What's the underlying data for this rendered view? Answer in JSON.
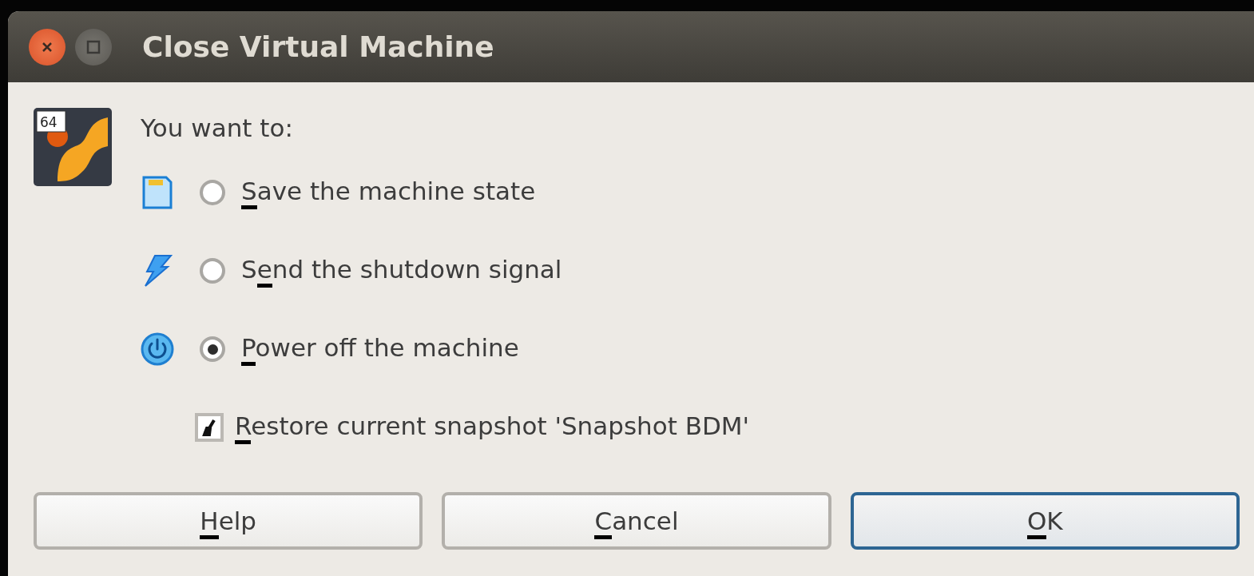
{
  "window": {
    "title": "Close Virtual Machine"
  },
  "logo_badge": "64",
  "prompt": "You want to:",
  "options": [
    {
      "kind": "save",
      "key": "S",
      "label_tail": "ave the machine state",
      "selected": false
    },
    {
      "kind": "shutdown",
      "label_head": "S",
      "key": "e",
      "label_tail": "nd the shutdown signal",
      "selected": false
    },
    {
      "kind": "poweroff",
      "key": "P",
      "label_tail": "ower off the machine",
      "selected": true
    }
  ],
  "restore_snapshot": {
    "key": "R",
    "label_tail": "estore current snapshot 'Snapshot BDM'",
    "checked": true
  },
  "buttons": [
    {
      "key": "H",
      "label_tail": "elp",
      "default": false
    },
    {
      "key": "C",
      "label_tail": "ancel",
      "default": false
    },
    {
      "key": "O",
      "label_tail": "K",
      "default": true
    }
  ]
}
